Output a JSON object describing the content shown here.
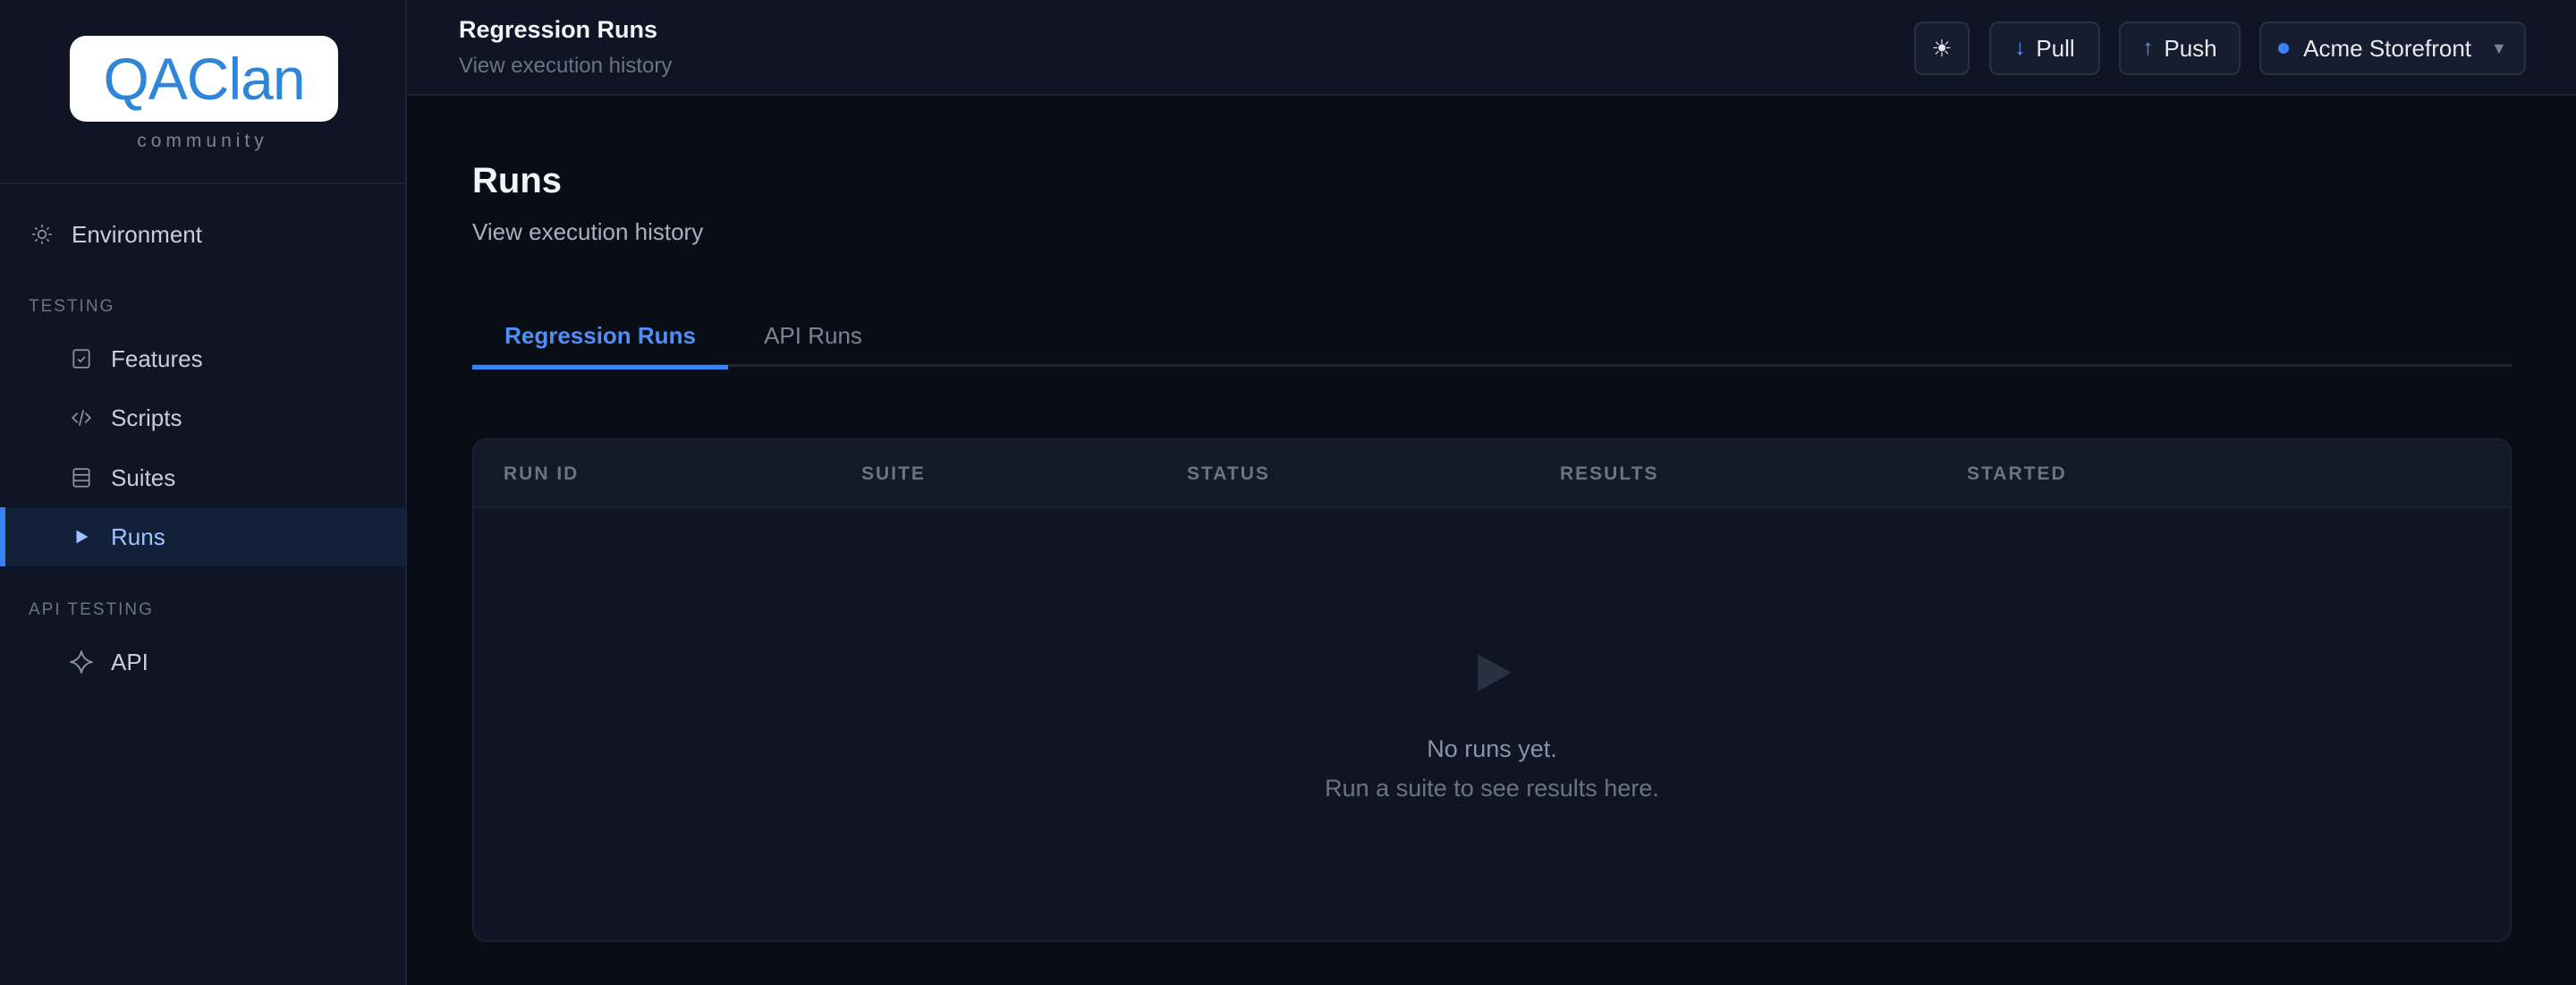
{
  "brand": {
    "logo_text": "QAClan",
    "tagline": "community"
  },
  "sidebar": {
    "environment": {
      "label": "Environment",
      "icon": "sun-icon"
    },
    "sections": [
      {
        "label": "TESTING",
        "items": [
          {
            "label": "Features",
            "icon": "checklist-icon"
          },
          {
            "label": "Scripts",
            "icon": "code-icon"
          },
          {
            "label": "Suites",
            "icon": "stack-icon"
          },
          {
            "label": "Runs",
            "icon": "play-icon",
            "active": true
          }
        ]
      },
      {
        "label": "API TESTING",
        "items": [
          {
            "label": "API",
            "icon": "sparkle-icon"
          }
        ]
      }
    ]
  },
  "topbar": {
    "title": "Regression Runs",
    "subtitle": "View execution history",
    "theme_toggle": "☀",
    "pull_arrow": "↓",
    "pull_label": "Pull",
    "push_arrow": "↑",
    "push_label": "Push",
    "project": "Acme Storefront",
    "project_caret": "▼"
  },
  "main": {
    "title": "Runs",
    "subtitle": "View execution history",
    "tabs": [
      {
        "label": "Regression Runs",
        "active": true
      },
      {
        "label": "API Runs",
        "active": false
      }
    ],
    "table": {
      "columns": [
        "RUN ID",
        "SUITE",
        "STATUS",
        "RESULTS",
        "STARTED"
      ],
      "rows": [],
      "empty_title": "No runs yet.",
      "empty_hint": "Run a suite to see results here."
    }
  },
  "colors": {
    "accent": "#3b82f6",
    "background": "#090d16",
    "sidebar": "#0f1524"
  }
}
